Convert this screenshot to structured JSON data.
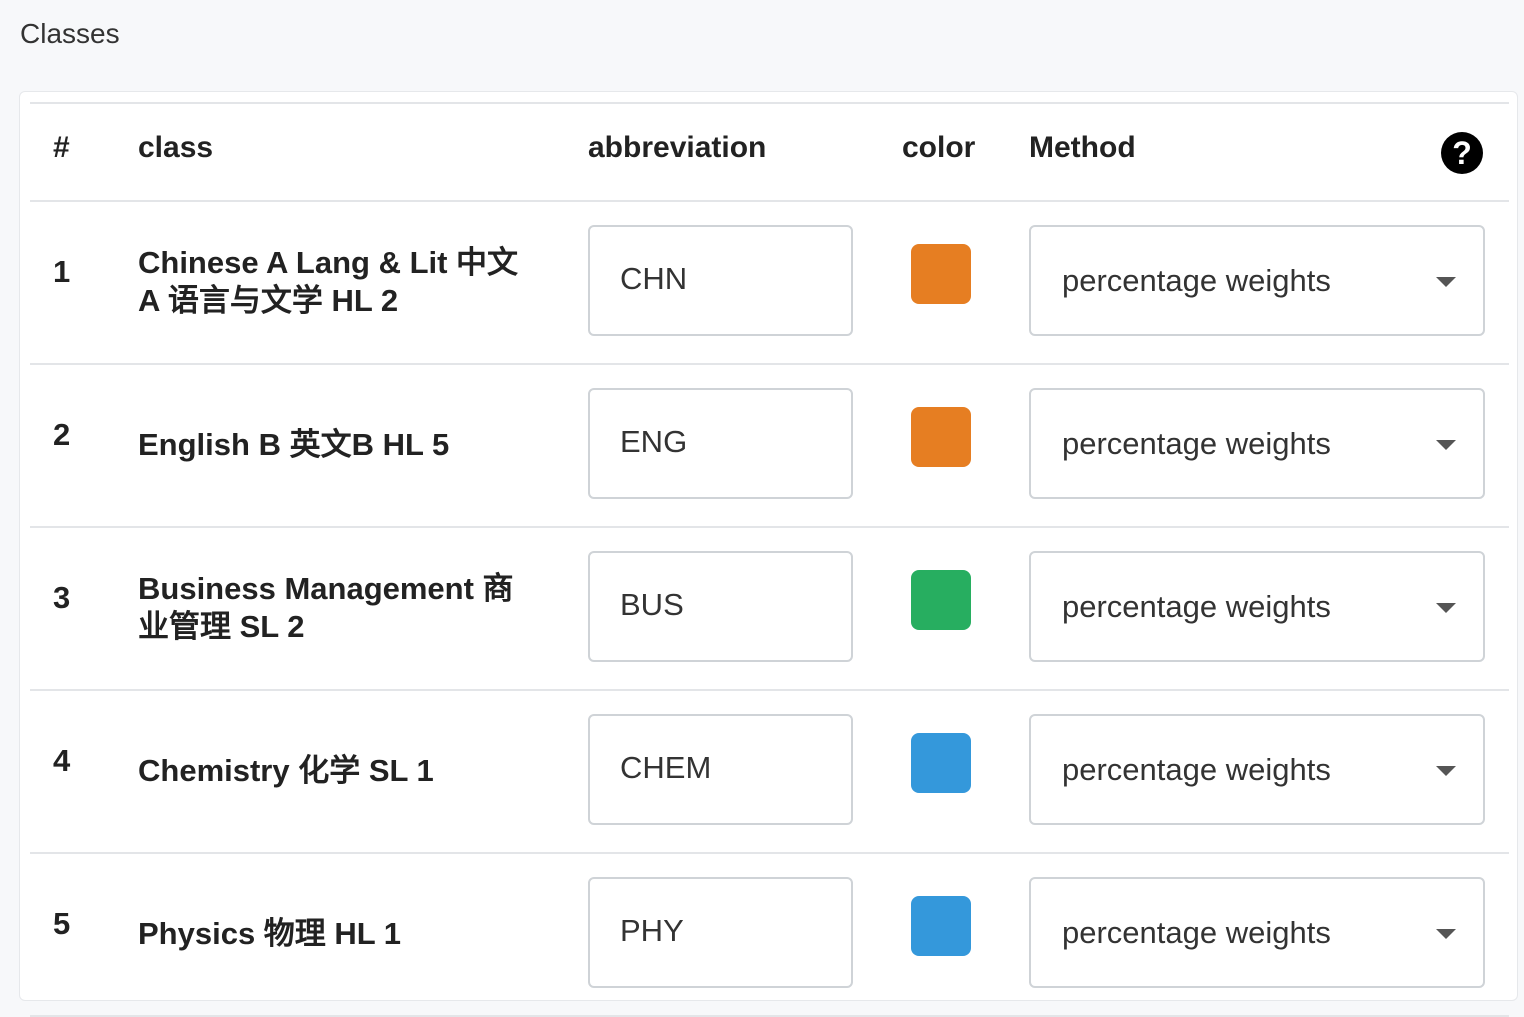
{
  "page": {
    "title": "Classes"
  },
  "table": {
    "headers": {
      "num": "#",
      "class": "class",
      "abbreviation": "abbreviation",
      "color": "color",
      "method": "Method"
    },
    "help_icon": "question-circle-icon",
    "help_glyph": "?",
    "rows": [
      {
        "num": "1",
        "class_line1": "Chinese A Lang & Lit 中文",
        "class_line2": "A 语言与文学 HL 2",
        "abbreviation": "CHN",
        "color": "#e67e22",
        "method": "percentage weights"
      },
      {
        "num": "2",
        "class_line1": "English B 英文B HL 5",
        "class_line2": "",
        "abbreviation": "ENG",
        "color": "#e67e22",
        "method": "percentage weights"
      },
      {
        "num": "3",
        "class_line1": "Business Management 商",
        "class_line2": "业管理 SL 2",
        "abbreviation": "BUS",
        "color": "#27ae60",
        "method": "percentage weights"
      },
      {
        "num": "4",
        "class_line1": "Chemistry 化学 SL 1",
        "class_line2": "",
        "abbreviation": "CHEM",
        "color": "#3498db",
        "method": "percentage weights"
      },
      {
        "num": "5",
        "class_line1": "Physics 物理 HL 1",
        "class_line2": "",
        "abbreviation": "PHY",
        "color": "#3498db",
        "method": "percentage weights"
      }
    ]
  }
}
